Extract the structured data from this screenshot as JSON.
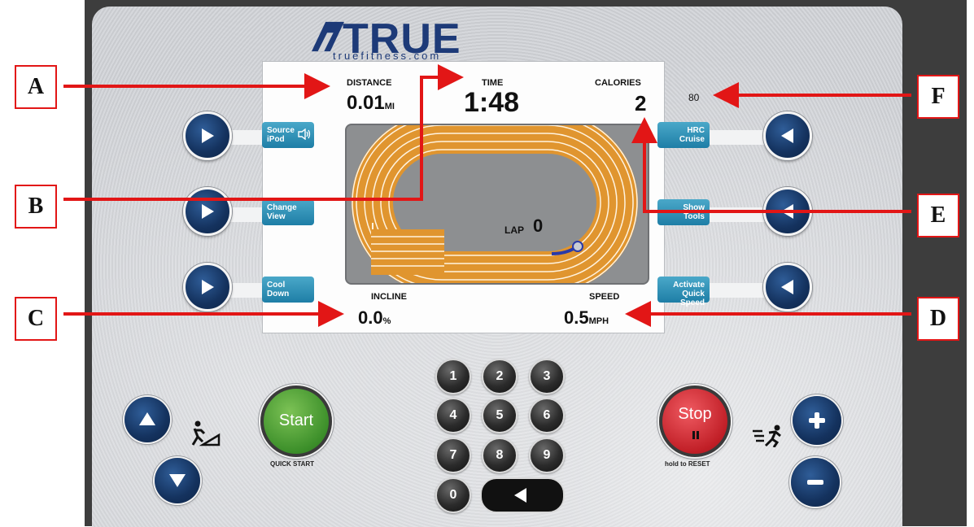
{
  "brand": {
    "name": "TRUE",
    "site": "truefitness.com",
    "color": "#1d3a78"
  },
  "screen": {
    "distance": {
      "label": "DISTANCE",
      "value": "0.01",
      "unit": "MI"
    },
    "time": {
      "label": "TIME",
      "value": "1:48"
    },
    "calories": {
      "label": "CALORIES",
      "value": "2"
    },
    "heart_rate": "80",
    "lap": {
      "label": "LAP",
      "value": "0"
    },
    "incline": {
      "label": "INCLINE",
      "value": "0.0",
      "unit": "%"
    },
    "speed": {
      "label": "SPEED",
      "value": "0.5",
      "unit": "MPH"
    }
  },
  "left_softkeys": [
    {
      "line1": "Source",
      "line2": "iPod",
      "icon": "speaker-icon"
    },
    {
      "line1": "Change",
      "line2": "View"
    },
    {
      "line1": "Cool",
      "line2": "Down"
    }
  ],
  "right_softkeys": [
    {
      "line1": "HRC",
      "line2": "Cruise"
    },
    {
      "line1": "Show",
      "line2": "Tools"
    },
    {
      "line1": "Activate",
      "line2": "Quick Speed"
    }
  ],
  "callouts": [
    "A",
    "B",
    "C",
    "D",
    "E",
    "F"
  ],
  "keypad": [
    "1",
    "2",
    "3",
    "4",
    "5",
    "6",
    "7",
    "8",
    "9",
    "0"
  ],
  "controls": {
    "start_label": "Start",
    "start_caption": "QUICK START",
    "stop_label": "Stop",
    "stop_caption": "hold to RESET"
  },
  "colors": {
    "callout_red": "#e21616",
    "track_orange": "#e0952f",
    "start_green": "#3c8f2a",
    "stop_red": "#c11f27",
    "button_navy": "#14325e",
    "softkey_blue": "#1e7ea6"
  }
}
